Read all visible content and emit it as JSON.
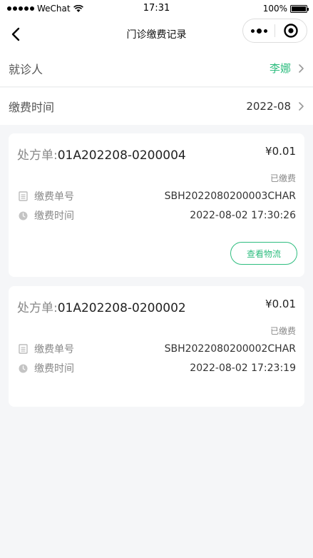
{
  "status_bar": {
    "carrier": "WeChat",
    "time": "17:31",
    "battery": "100%"
  },
  "nav": {
    "title": "门诊缴费记录"
  },
  "patient_row": {
    "label": "就诊人",
    "value": "李娜"
  },
  "date_row": {
    "label": "缴费时间",
    "value": "2022-08"
  },
  "records": [
    {
      "rx_label": "处方单:",
      "rx_no": "01A202208-0200004",
      "amount": "¥0.01",
      "status": "已缴费",
      "bill_label": "缴费单号",
      "bill_no": "SBH2022080200003CHAR",
      "time_label": "缴费时间",
      "time": "2022-08-02 17:30:26",
      "action": "查看物流"
    },
    {
      "rx_label": "处方单:",
      "rx_no": "01A202208-0200002",
      "amount": "¥0.01",
      "status": "已缴费",
      "bill_label": "缴费单号",
      "bill_no": "SBH2022080200002CHAR",
      "time_label": "缴费时间",
      "time": "2022-08-02 17:23:19"
    }
  ],
  "colors": {
    "accent": "#2ebd7f",
    "background": "#f5f6f8"
  }
}
